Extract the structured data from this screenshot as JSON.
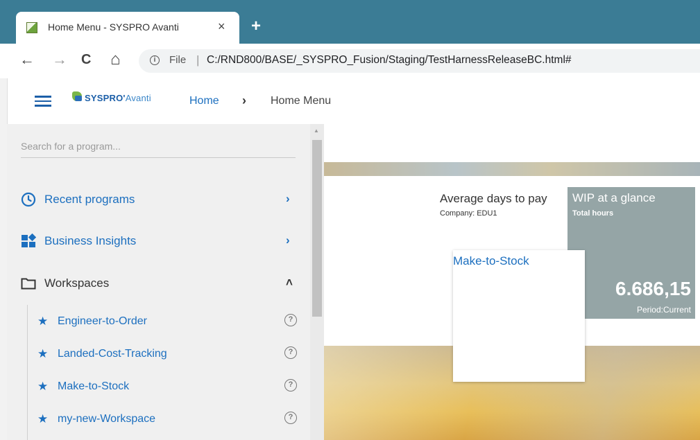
{
  "browser": {
    "tab_title": "Home Menu - SYSPRO Avanti",
    "tab_close": "×",
    "new_tab": "+",
    "nav": {
      "back": "←",
      "forward": "→",
      "reload": "C",
      "home": "⌂"
    },
    "info_glyph": "i",
    "file_label": "File",
    "separator": "|",
    "url": "C:/RND800/BASE/_SYSPRO_Fusion/Staging/TestHarnessReleaseBC.html#"
  },
  "header": {
    "logo_main": "SYSPRO",
    "logo_suffix": "Avanti",
    "breadcrumb_home": "Home",
    "breadcrumb_sep": "›",
    "breadcrumb_current": "Home Menu"
  },
  "sidebar": {
    "search_placeholder": "Search for a program...",
    "items": [
      {
        "label": "Recent programs",
        "icon": "clock-icon",
        "chevron": "›"
      },
      {
        "label": "Business Insights",
        "icon": "dashboard-icon",
        "chevron": "›"
      },
      {
        "label": "Workspaces",
        "icon": "folder-icon",
        "chevron": "˄"
      }
    ],
    "workspaces": [
      {
        "label": "Engineer-to-Order",
        "star": "★",
        "help": "?"
      },
      {
        "label": "Landed-Cost-Tracking",
        "star": "★",
        "help": "?"
      },
      {
        "label": "Make-to-Stock",
        "star": "★",
        "help": "?"
      },
      {
        "label": "my-new-Workspace",
        "star": "★",
        "help": "?"
      }
    ],
    "scroll_up": "▲"
  },
  "main": {
    "days_tile": {
      "title": "Average days to pay",
      "subtitle": "Company: EDU1"
    },
    "wip_tile": {
      "title": "WIP at a glance",
      "subtitle": "Total hours",
      "value": "6.686,15",
      "period": "Period:Current"
    },
    "popup": {
      "title": "Make-to-Stock"
    }
  },
  "colors": {
    "tabbar": "#3b7c95",
    "accent_blue": "#1c6fbf",
    "sidebar_bg": "#f0f0f0",
    "wip_tile": "#95a5a6"
  }
}
